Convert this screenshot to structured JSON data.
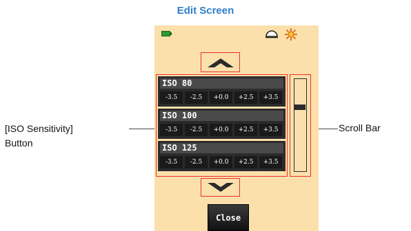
{
  "header": {
    "title": "Edit Screen"
  },
  "status_icons": [
    "battery-icon",
    "dome-icon",
    "sun-icon"
  ],
  "iso_rows": [
    {
      "label": "ISO 80",
      "comps": [
        "-3.5",
        "-2.5",
        "+0.0",
        "+2.5",
        "+3.5"
      ]
    },
    {
      "label": "ISO 100",
      "comps": [
        "-3.5",
        "-2.5",
        "+0.0",
        "+2.5",
        "+3.5"
      ]
    },
    {
      "label": "ISO 125",
      "comps": [
        "-3.5",
        "-2.5",
        "+0.0",
        "+2.5",
        "+3.5"
      ]
    }
  ],
  "buttons": {
    "close_label": "Close"
  },
  "callouts": {
    "iso_button_line1": "[ISO Sensitivity]",
    "iso_button_line2": "Button",
    "scroll_bar": "Scroll Bar"
  },
  "colors": {
    "title": "#2e7ec8",
    "screen_bg": "#fbe0ab",
    "highlight": "#e8302c",
    "row_bg": "#2b2b2b"
  }
}
